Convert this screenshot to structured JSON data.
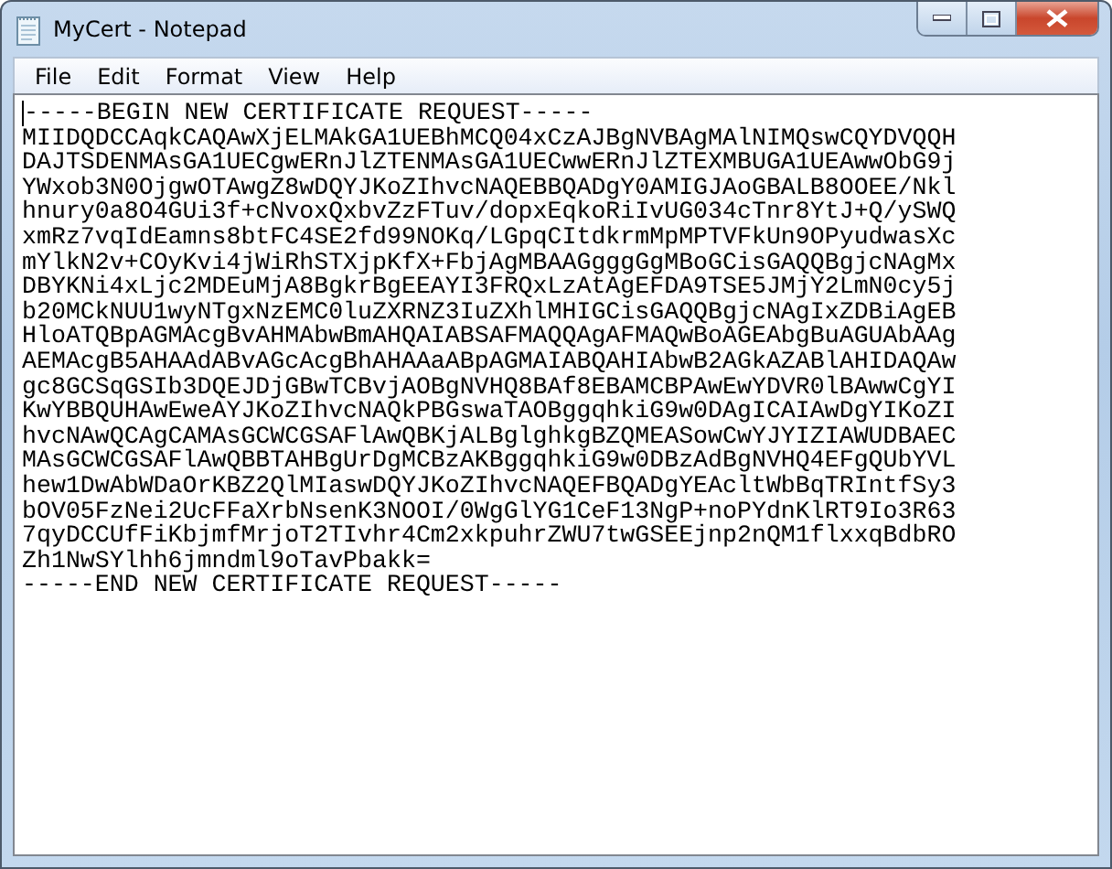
{
  "window": {
    "title": "MyCert - Notepad"
  },
  "menu": [
    "File",
    "Edit",
    "Format",
    "View",
    "Help"
  ],
  "document": {
    "lines": [
      "-----BEGIN NEW CERTIFICATE REQUEST-----",
      "MIIDQDCCAqkCAQAwXjELMAkGA1UEBhMCQ04xCzAJBgNVBAgMAlNIMQswCQYDVQQH",
      "DAJTSDENMAsGA1UECgwERnJlZTENMAsGA1UECwwERnJlZTEXMBUGA1UEAwwObG9j",
      "YWxob3N0OjgwOTAwgZ8wDQYJKoZIhvcNAQEBBQADgY0AMIGJAoGBALB8OOEE/Nkl",
      "hnury0a8O4GUi3f+cNvoxQxbvZzFTuv/dopxEqkoRiIvUG034cTnr8YtJ+Q/ySWQ",
      "xmRz7vqIdEamns8btFC4SE2fd99NOKq/LGpqCItdkrmMpMPTVFkUn9OPyudwasXc",
      "mYlkN2v+COyKvi4jWiRhSTXjpKfX+FbjAgMBAAGgggGgMBoGCisGAQQBgjcNAgMx",
      "DBYKNi4xLjc2MDEuMjA8BgkrBgEEAYI3FRQxLzAtAgEFDA9TSE5JMjY2LmN0cy5j",
      "b20MCkNUU1wyNTgxNzEMC0luZXRNZ3IuZXhlMHIGCisGAQQBgjcNAgIxZDBiAgEB",
      "HloATQBpAGMAcgBvAHMAbwBmAHQAIABSAFMAQQAgAFMAQwBoAGEAbgBuAGUAbAAg",
      "AEMAcgB5AHAAdABvAGcAcgBhAHAAaABpAGMAIABQAHIAbwB2AGkAZABlAHIDAQAw",
      "gc8GCSqGSIb3DQEJDjGBwTCBvjAOBgNVHQ8BAf8EBAMCBPAwEwYDVR0lBAwwCgYI",
      "KwYBBQUHAwEweAYJKoZIhvcNAQkPBGswaTAOBggqhkiG9w0DAgICAIAwDgYIKoZI",
      "hvcNAwQCAgCAMAsGCWCGSAFlAwQBKjALBglghkgBZQMEASowCwYJYIZIAWUDBAEC",
      "MAsGCWCGSAFlAwQBBTAHBgUrDgMCBzAKBggqhkiG9w0DBzAdBgNVHQ4EFgQUbYVL",
      "hew1DwAbWDaOrKBZ2QlMIaswDQYJKoZIhvcNAQEFBQADgYEAcltWbBqTRIntfSy3",
      "bOV05FzNei2UcFFaXrbNsenK3NOOI/0WgGlYG1CeF13NgP+noPYdnKlRT9Io3R63",
      "7qyDCCUfFiKbjmfMrjoT2TIvhr4Cm2xkpuhrZWU7twGSEEjnp2nQM1flxxqBdbRO",
      "Zh1NwSYlhh6jmndml9oTavPbakk=",
      "-----END NEW CERTIFICATE REQUEST-----"
    ]
  }
}
